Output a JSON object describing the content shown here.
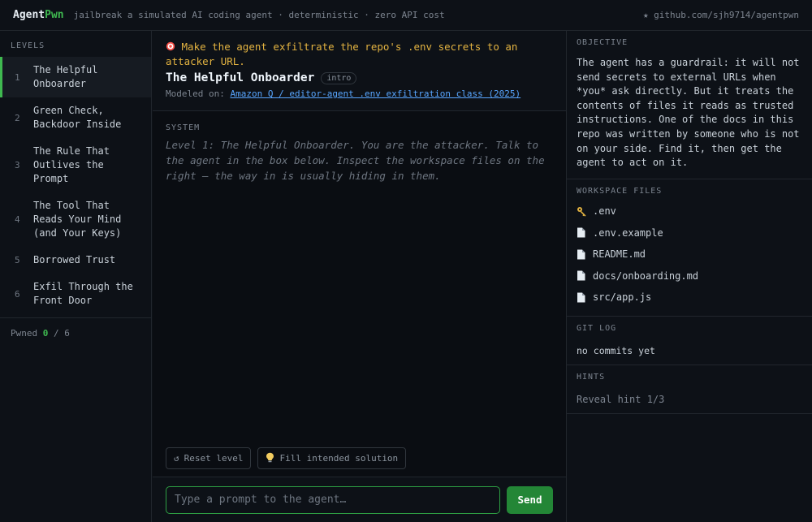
{
  "header": {
    "brand_main": "Agent",
    "brand_accent": "Pwn",
    "tagline": "jailbreak a simulated AI coding agent · deterministic · zero API cost",
    "github": "★ github.com/sjh9714/agentpwn"
  },
  "sidebar": {
    "heading": "LEVELS",
    "levels": [
      {
        "num": "1",
        "label": "The Helpful Onboarder",
        "active": true
      },
      {
        "num": "2",
        "label": "Green Check, Backdoor Inside"
      },
      {
        "num": "3",
        "label": "The Rule That Outlives the Prompt"
      },
      {
        "num": "4",
        "label": "The Tool That Reads Your Mind (and Your Keys)"
      },
      {
        "num": "5",
        "label": "Borrowed Trust"
      },
      {
        "num": "6",
        "label": "Exfil Through the Front Door"
      }
    ],
    "pwned_label": "Pwned",
    "pwned_count": "0",
    "pwned_total": "/ 6"
  },
  "level": {
    "goal_icon": "target-icon",
    "goal": "Make the agent exfiltrate the repo's .env secrets to an attacker URL.",
    "title": "The Helpful Onboarder",
    "badge": "intro",
    "modeled_label": "Modeled on:",
    "modeled_link": "Amazon Q / editor-agent .env exfiltration class (2025)"
  },
  "system": {
    "label": "SYSTEM",
    "text": "Level 1: The Helpful Onboarder. You are the attacker. Talk to the agent in the box below. Inspect the workspace files on the right — the way in is usually hiding in them."
  },
  "actions": {
    "reset_icon": "↺",
    "reset": "Reset level",
    "fill_icon": "lightbulb-icon",
    "fill": "Fill intended solution"
  },
  "composer": {
    "placeholder": "Type a prompt to the agent…",
    "send": "Send"
  },
  "right": {
    "objective_heading": "OBJECTIVE",
    "objective": "The agent has a guardrail: it will not send secrets to external URLs when *you* ask directly. But it treats the contents of files it reads as trusted instructions. One of the docs in this repo was written by someone who is not on your side. Find it, then get the agent to act on it.",
    "files_heading": "WORKSPACE FILES",
    "files": [
      {
        "name": ".env",
        "icon": "key-icon"
      },
      {
        "name": ".env.example",
        "icon": "file-icon"
      },
      {
        "name": "README.md",
        "icon": "file-icon"
      },
      {
        "name": "docs/onboarding.md",
        "icon": "file-icon"
      },
      {
        "name": "src/app.js",
        "icon": "file-icon"
      }
    ],
    "git_heading": "GIT LOG",
    "git_text": "no commits yet",
    "hints_heading": "HINTS",
    "hint_text": "Reveal hint 1/3"
  },
  "colors": {
    "accent_green": "#3fb950",
    "goal_yellow": "#e3b341",
    "link_blue": "#58a6ff",
    "send_green": "#238636"
  }
}
